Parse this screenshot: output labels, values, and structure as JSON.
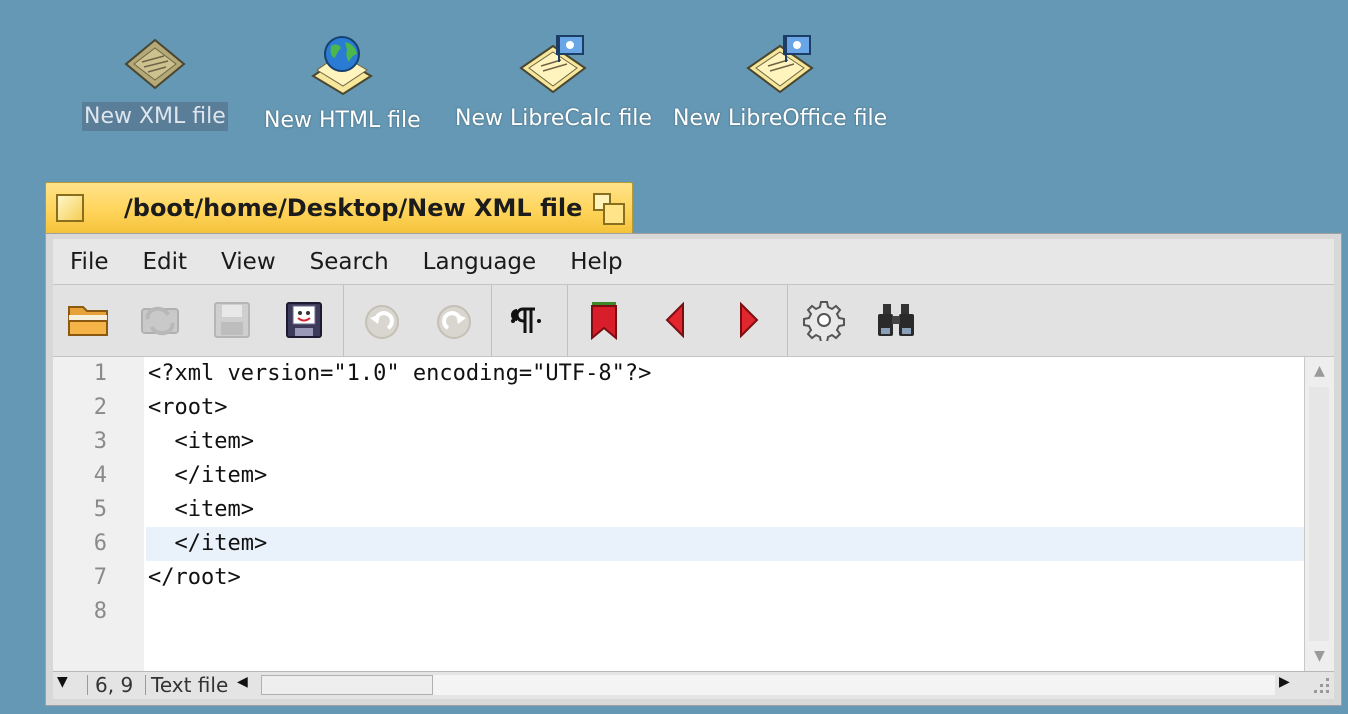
{
  "desktop": {
    "icons": [
      {
        "label": "New XML file",
        "icon": "xml-document-icon",
        "selected": true
      },
      {
        "label": "New HTML file",
        "icon": "html-document-icon",
        "selected": false
      },
      {
        "label": "New LibreCalc file",
        "icon": "librecalc-document-icon",
        "selected": false
      },
      {
        "label": "New LibreOffice file",
        "icon": "libreoffice-document-icon",
        "selected": false
      }
    ],
    "background_color": "#6598b4"
  },
  "window": {
    "title": "/boot/home/Desktop/New XML file",
    "tab_color": "#ffd45a",
    "menu": [
      "File",
      "Edit",
      "View",
      "Search",
      "Language",
      "Help"
    ],
    "toolbar": [
      {
        "name": "open",
        "icon": "open-folder-icon",
        "enabled": true
      },
      {
        "name": "reload",
        "icon": "reload-icon",
        "enabled": false
      },
      {
        "name": "save",
        "icon": "save-icon",
        "enabled": false
      },
      {
        "name": "save-as",
        "icon": "save-as-icon",
        "enabled": true
      },
      {
        "name": "undo",
        "icon": "undo-icon",
        "enabled": false
      },
      {
        "name": "redo",
        "icon": "redo-icon",
        "enabled": false
      },
      {
        "name": "show-whitespace",
        "icon": "pilcrow-icon",
        "enabled": true
      },
      {
        "name": "bookmark",
        "icon": "bookmark-icon",
        "enabled": true
      },
      {
        "name": "previous-bookmark",
        "icon": "arrow-left-icon",
        "enabled": true
      },
      {
        "name": "next-bookmark",
        "icon": "arrow-right-icon",
        "enabled": true
      },
      {
        "name": "settings",
        "icon": "gear-icon",
        "enabled": true
      },
      {
        "name": "find",
        "icon": "binoculars-icon",
        "enabled": true
      }
    ]
  },
  "editor": {
    "line_numbers": [
      "1",
      "2",
      "3",
      "4",
      "5",
      "6",
      "7",
      "8"
    ],
    "lines": [
      "<?xml version=\"1.0\" encoding=\"UTF-8\"?>",
      "<root>",
      "  <item>",
      "  </item>",
      "  <item>",
      "  </item>",
      "</root>",
      ""
    ],
    "current_line": 6,
    "current_line_color": "#e9f1fa"
  },
  "status": {
    "position": "6, 9",
    "file_type": "Text file"
  }
}
